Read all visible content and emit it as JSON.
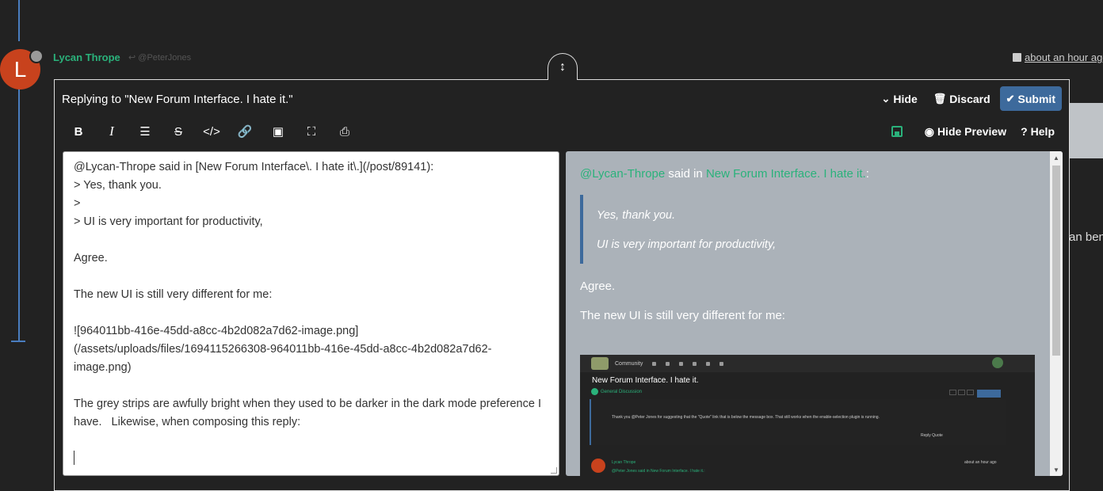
{
  "background_post": {
    "author": "Lycan Thrope",
    "avatar_letter": "L",
    "reply_to": "@PeterJones",
    "timestamp": "about an hour ago",
    "overflow_text": "an ben"
  },
  "composer": {
    "title": "Replying to \"New Forum Interface. I hate it.\"",
    "hide_label": "Hide",
    "discard_label": "Discard",
    "submit_label": "Submit",
    "hide_preview_label": "Hide Preview",
    "help_label": "Help",
    "editor_text": "@Lycan-Thrope said in [New Forum Interface\\. I hate it\\.](/post/89141):\n> Yes, thank you.\n>\n> UI is very important for productivity,\n\nAgree.\n\nThe new UI is still very different for me:\n\n![964011bb-416e-45dd-a8cc-4b2d082a7d62-image.png]\n(/assets/uploads/files/1694115266308-964011bb-416e-45dd-a8cc-4b2d082a7d62-image.png)\n\nThe grey strips are awfully bright when they used to be darker in the dark mode preference I have.   Likewise, when composing this reply:\n\n"
  },
  "preview": {
    "mention": "@Lycan-Thrope",
    "said_in": " said in ",
    "topic_link": "New Forum Interface. I hate it.",
    "colon": ":",
    "quote_lines": [
      "Yes, thank you.",
      "UI is very important for productivity,"
    ],
    "paragraphs": [
      "Agree.",
      "The new UI is still very different for me:"
    ],
    "image": {
      "site_name": "Community",
      "topic_title": "New Forum Interface. I hate it.",
      "category": "General Discussion",
      "reply_button": "Reply",
      "line1": "Thank you @Peter Jones for suggesting that the \"Quote\" link that is below the message box. That still works when the enable-selection plugin is running.",
      "line2": "Reply     Quote",
      "author": "Lycan Thrope",
      "time": "about an hour ago",
      "mention_line": "@Peter Jones said in New Forum Interface. I hate it.:"
    }
  },
  "colors": {
    "background": "#222222",
    "accent_green": "#2ab27b",
    "primary_blue": "#3d6a9c",
    "preview_bg": "#abb2b9",
    "avatar": "#c8421d"
  },
  "icons": {
    "resize": "resize-vertical-icon",
    "hide": "chevron-down-icon",
    "discard": "trash-icon",
    "submit": "check-icon",
    "save": "floppy-disk-icon",
    "preview": "eye-icon",
    "help": "question-icon"
  }
}
